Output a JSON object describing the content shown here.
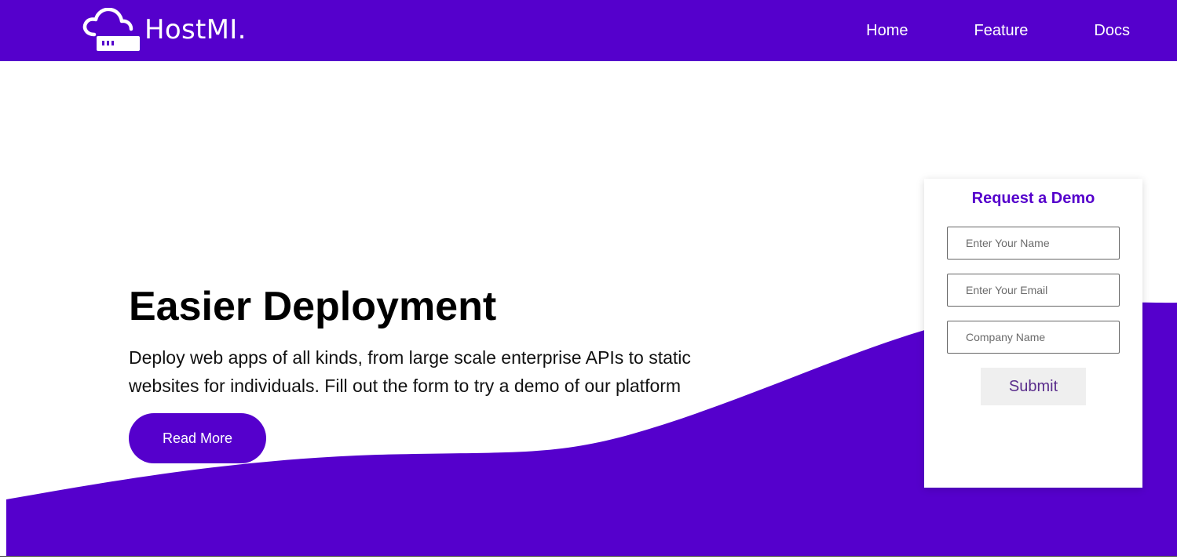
{
  "brand": {
    "name": "HostMI.",
    "icon": "cloud-server-icon"
  },
  "nav": {
    "items": [
      {
        "label": "Home"
      },
      {
        "label": "Feature"
      },
      {
        "label": "Docs"
      }
    ]
  },
  "hero": {
    "title": "Easier Deployment",
    "description": "Deploy web apps of all kinds, from large scale enterprise APIs to static websites for individuals. Fill out the form to try a demo of our platform",
    "read_more_label": "Read More"
  },
  "demo_form": {
    "title": "Request a Demo",
    "name_placeholder": "Enter Your Name",
    "email_placeholder": "Enter Your Email",
    "company_placeholder": "Company Name",
    "submit_label": "Submit"
  },
  "colors": {
    "brand": "#5500cc",
    "background": "#ffffff",
    "button_light": "#efefef",
    "submit_text": "#5a2d8c"
  }
}
